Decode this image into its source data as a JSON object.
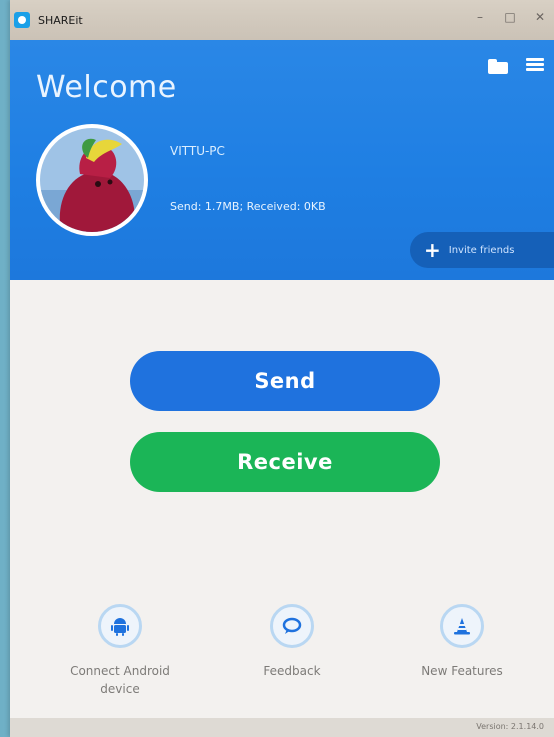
{
  "window": {
    "title": "SHAREit",
    "controls": [
      "minimize-icon",
      "maximize-icon",
      "close-icon"
    ]
  },
  "header": {
    "welcome": "Welcome",
    "device_name": "VITTU-PC",
    "stats": "Send: 1.7MB; Received: 0KB",
    "invite_label": "Invite friends",
    "icons": [
      "folder-icon",
      "menu-icon"
    ]
  },
  "actions": {
    "send_label": "Send",
    "receive_label": "Receive"
  },
  "bottom": {
    "connect_android_line1": "Connect Android",
    "connect_android_line2": "device",
    "feedback": "Feedback",
    "new_features": "New Features"
  },
  "footer": {
    "version": "Version: 2.1.14.0"
  },
  "colors": {
    "header_blue": "#1f7fe3",
    "send_blue": "#1f72de",
    "receive_green": "#1bb557"
  }
}
